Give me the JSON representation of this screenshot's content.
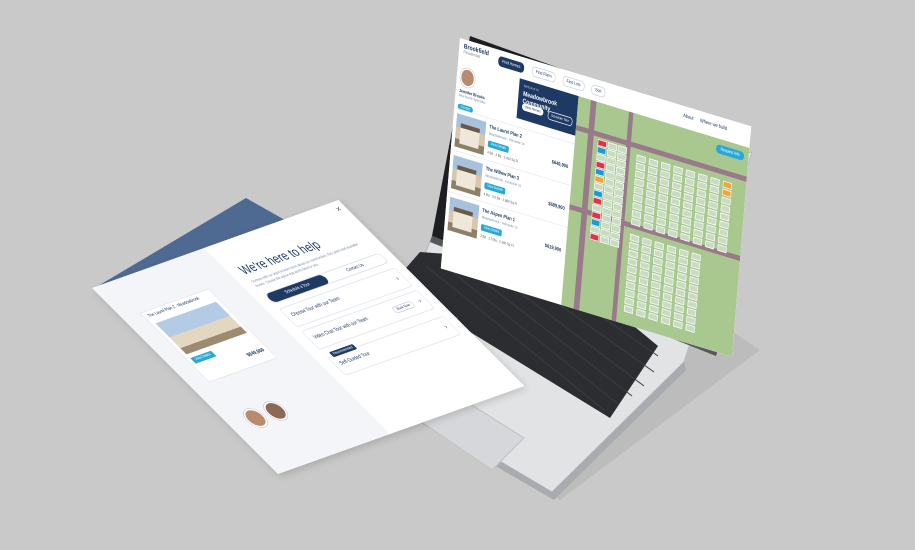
{
  "laptop": {
    "brand": "Brookfield",
    "brand_sub": "Residential",
    "nav": [
      "About",
      "Where we build"
    ],
    "nav_pills": [
      "Find Homes",
      "Find Plans",
      "Find Lots",
      "Sort"
    ],
    "community": {
      "pre": "Welcome to",
      "name": "Meadowbrook Community",
      "buttons": [
        "View Homes",
        "Schedule Tour"
      ]
    },
    "agent": {
      "name": "Jennifer Brooks",
      "role": "New Home Specialist",
      "button": "Contact"
    },
    "homes": [
      {
        "title": "The Laurel Plan 2",
        "sub": "Meadowbrook · Homesite 24",
        "price": "$649,900",
        "button": "View Details",
        "specs": "4 Bd · 3 Ba · 2,410 Sq Ft"
      },
      {
        "title": "The Willow Plan 3",
        "sub": "Meadowbrook · Homesite 31",
        "price": "$689,900",
        "button": "View Details",
        "specs": "4 Bd · 3.5 Ba · 2,680 Sq Ft"
      },
      {
        "title": "The Aspen Plan 1",
        "sub": "Meadowbrook · Homesite 12",
        "price": "$619,900",
        "button": "View Details",
        "specs": "3 Bd · 2.5 Ba · 2,150 Sq Ft"
      }
    ],
    "map_button": "Request Info",
    "colors": {
      "navy": "#1e3a64",
      "accent": "#2aa7d6",
      "sold": "#e0334a",
      "available": "#1c9ad6",
      "hold": "#f2a53a"
    }
  },
  "tablet": {
    "card_caption": "The Laurel Plan 2 · Meadowbrook",
    "card_button": "View Details",
    "card_price": "$649,900",
    "title": "We're here to help",
    "subtitle": "Connect with our team to learn more about our communities, floor plans and available homes. Choose the option that works best for you.",
    "tabs": [
      "Schedule a Tour",
      "Contact Us"
    ],
    "options": [
      {
        "tag": "",
        "label": "Choose Tour with our Team",
        "pill": ""
      },
      {
        "tag": "",
        "label": "Video Chat Tour with our Team",
        "pill": "Book Now"
      },
      {
        "tag": "Recommended",
        "label": "Self-Guided Tour",
        "pill": ""
      }
    ],
    "close_glyph": "✕",
    "arrow_glyph": "›"
  }
}
